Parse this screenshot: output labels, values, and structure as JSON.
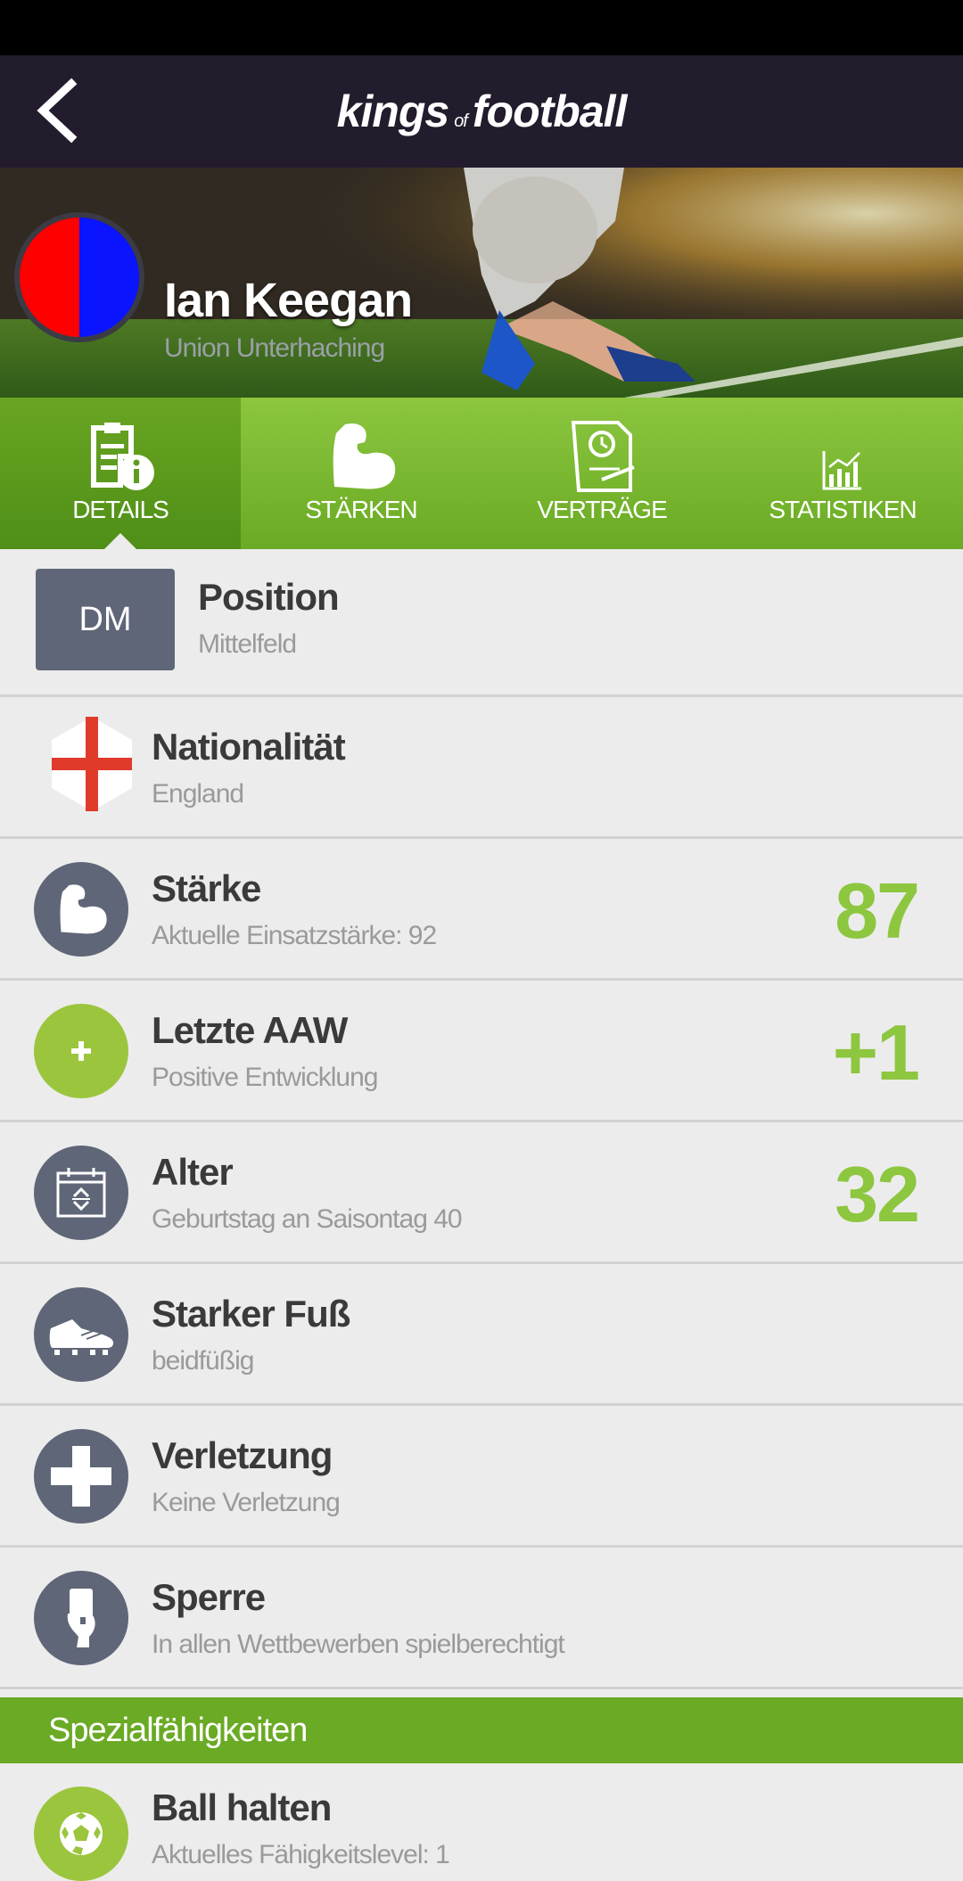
{
  "header": {
    "logo_part1": "kings",
    "logo_part2": "of",
    "logo_part3": "football"
  },
  "player": {
    "name": "Ian Keegan",
    "club": "Union Unterhaching",
    "club_colors": [
      "#ff0000",
      "#0a14ff"
    ]
  },
  "tabs": [
    {
      "label": "DETAILS",
      "icon": "details-icon",
      "active": true
    },
    {
      "label": "STÄRKEN",
      "icon": "flexed-arm-icon",
      "active": false
    },
    {
      "label": "VERTRÄGE",
      "icon": "contract-icon",
      "active": false
    },
    {
      "label": "STATISTIKEN",
      "icon": "bar-chart-icon",
      "active": false
    }
  ],
  "details": {
    "position": {
      "badge": "DM",
      "title": "Position",
      "sub": "Mittelfeld"
    },
    "nationality": {
      "title": "Nationalität",
      "sub": "England",
      "icon": "england-flag-icon"
    },
    "strength": {
      "title": "Stärke",
      "sub": "Aktuelle Einsatzstärke: 92",
      "value": "87",
      "icon": "flexed-arm-icon"
    },
    "last_aaw": {
      "title": "Letzte AAW",
      "sub": "Positive Entwicklung",
      "value": "+1",
      "icon": "plus-icon"
    },
    "age": {
      "title": "Alter",
      "sub": "Geburtstag an Saisontag 40",
      "value": "32",
      "icon": "calendar-icon"
    },
    "foot": {
      "title": "Starker Fuß",
      "sub": "beidfüßig",
      "icon": "football-boot-icon"
    },
    "injury": {
      "title": "Verletzung",
      "sub": "Keine Verletzung",
      "icon": "medical-cross-icon"
    },
    "ban": {
      "title": "Sperre",
      "sub": "In allen Wettbewerben spielberechtigt",
      "icon": "referee-card-icon"
    }
  },
  "special": {
    "heading": "Spezialfähigkeiten",
    "items": [
      {
        "title": "Ball halten",
        "sub": "Aktuelles Fähigkeitslevel: 1",
        "icon": "soccer-ball-icon"
      }
    ]
  },
  "colors": {
    "accent_green": "#8dc63f",
    "icon_gray": "#5f6677",
    "appbar": "#231c2c"
  }
}
